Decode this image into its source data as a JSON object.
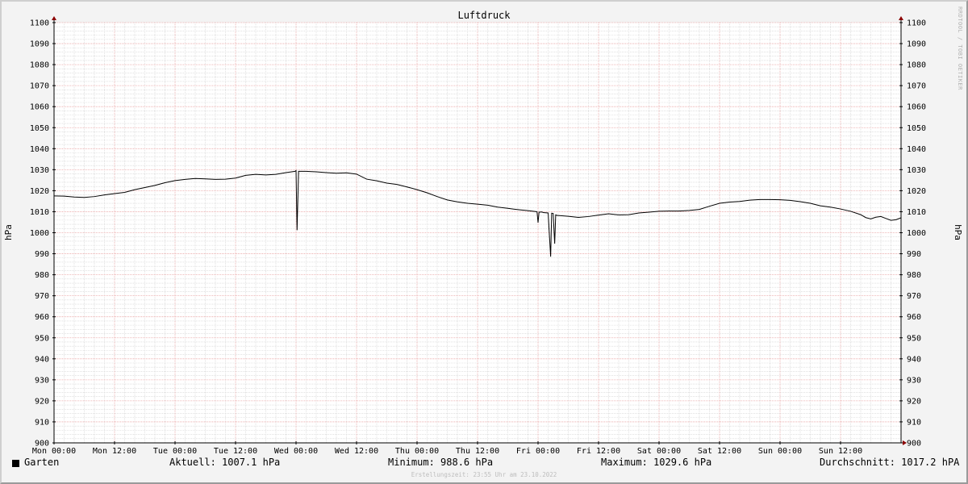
{
  "chart_data": {
    "type": "line",
    "title": "Luftdruck",
    "ylabel": "hPa",
    "ylim": [
      900,
      1100
    ],
    "yticks": [
      900,
      910,
      920,
      930,
      940,
      950,
      960,
      970,
      980,
      990,
      1000,
      1010,
      1020,
      1030,
      1040,
      1050,
      1060,
      1070,
      1080,
      1090,
      1100
    ],
    "x_ticks": [
      "Mon 00:00",
      "Mon 12:00",
      "Tue 00:00",
      "Tue 12:00",
      "Wed 00:00",
      "Wed 12:00",
      "Thu 00:00",
      "Thu 12:00",
      "Fri 00:00",
      "Fri 12:00",
      "Sat 00:00",
      "Sat 12:00",
      "Sun 00:00",
      "Sun 12:00"
    ],
    "x_unit": "hours from Mon 00:00",
    "xlim": [
      0,
      168
    ],
    "grid": true,
    "series": [
      {
        "name": "Garten",
        "color": "#000000",
        "x": [
          0,
          2,
          4,
          6,
          8,
          10,
          12,
          14,
          16,
          18,
          20,
          22,
          24,
          26,
          28,
          30,
          32,
          34,
          36,
          38,
          40,
          42,
          44,
          46,
          47.8,
          48,
          48.2,
          48.5,
          50,
          52,
          54,
          56,
          58,
          60,
          62,
          64,
          66,
          68,
          70,
          72,
          74,
          76,
          78,
          80,
          82,
          84,
          86,
          88,
          90,
          92,
          94,
          95.8,
          96,
          96.2,
          96.8,
          97,
          98,
          98.5,
          98.7,
          99,
          99.3,
          99.5,
          99.8,
          100,
          102,
          104,
          106,
          108,
          110,
          112,
          114,
          116,
          118,
          120,
          122,
          124,
          126,
          128,
          130,
          132,
          134,
          136,
          138,
          140,
          142,
          144,
          146,
          148,
          150,
          152,
          154,
          156,
          158,
          160,
          161,
          162,
          163,
          164,
          165,
          166,
          167,
          168
        ],
        "values": [
          1017.5,
          1017.4,
          1017,
          1016.8,
          1017.2,
          1018,
          1018.6,
          1019.2,
          1020.5,
          1021.5,
          1022.5,
          1023.8,
          1024.8,
          1025.4,
          1025.8,
          1025.6,
          1025.4,
          1025.5,
          1026,
          1027.3,
          1027.8,
          1027.5,
          1027.8,
          1028.6,
          1029.2,
          1029.6,
          1001.2,
          1029.2,
          1029.2,
          1029,
          1028.6,
          1028.3,
          1028.5,
          1027.9,
          1025.5,
          1024.7,
          1023.6,
          1023,
          1021.8,
          1020.5,
          1019,
          1017.2,
          1015.6,
          1014.7,
          1014,
          1013.6,
          1013.1,
          1012.2,
          1011.6,
          1011,
          1010.5,
          1010,
          1004.8,
          1009.8,
          1009.9,
          1009.6,
          1009.4,
          988.6,
          1009.3,
          1009.2,
          994.8,
          1008.5,
          1008.2,
          1008.2,
          1007.8,
          1007.3,
          1007.7,
          1008.4,
          1009,
          1008.5,
          1008.6,
          1009.4,
          1009.8,
          1010.2,
          1010.3,
          1010.3,
          1010.6,
          1011.1,
          1012.6,
          1014,
          1014.6,
          1014.9,
          1015.5,
          1015.8,
          1015.8,
          1015.7,
          1015.4,
          1014.8,
          1014,
          1012.8,
          1012.2,
          1011.3,
          1010.2,
          1008.6,
          1007.2,
          1006.6,
          1007.4,
          1007.7,
          1006.8,
          1005.9,
          1006.2,
          1007.1
        ]
      }
    ]
  },
  "watermark": "RRDTOOL / TOBI OETIKER",
  "legend": {
    "series_name": "Garten",
    "current": "Aktuell: 1007.1 hPa",
    "minimum": "Minimum: 988.6 hPa",
    "maximum": "Maximum: 1029.6 hPa",
    "average": "Durchschnitt: 1017.2 hPA"
  },
  "footer": "Erstellungszeit: 23:55 Uhr am 23.10.2022",
  "colors": {
    "major_grid": "#e9a2a2",
    "minor_grid": "#cfcfcf",
    "axis": "#000000",
    "arrow": "#8b0000",
    "background": "#f3f3f3",
    "plot_background": "#ffffff"
  }
}
